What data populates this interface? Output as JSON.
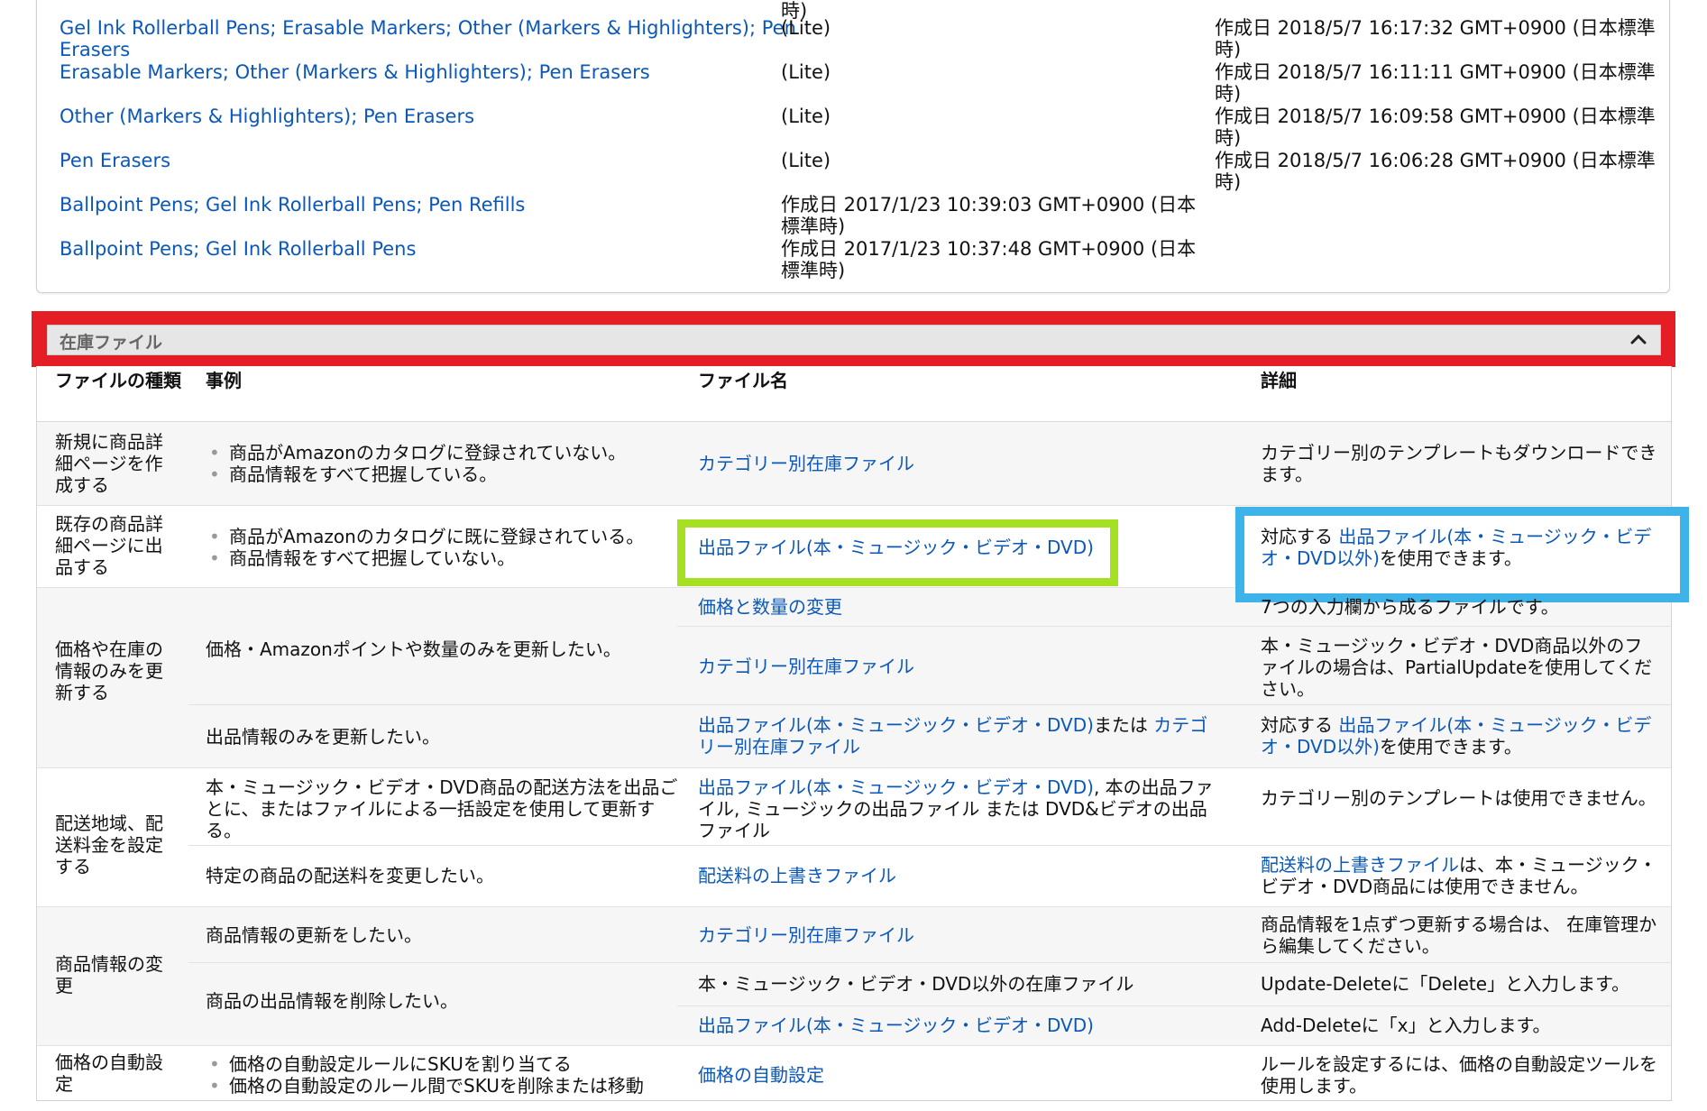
{
  "top_list": {
    "clipped_fragment": "時)",
    "rows": [
      {
        "name": "Gel Ink Rollerball Pens; Erasable Markers; Other (Markers & Highlighters); Pen Erasers",
        "mid": "(Lite)",
        "date": "作成日 2018/5/7 16:17:32 GMT+0900 (日本標準時)"
      },
      {
        "name": "Erasable Markers; Other (Markers & Highlighters); Pen Erasers",
        "mid": "(Lite)",
        "date": "作成日 2018/5/7 16:11:11 GMT+0900 (日本標準時)"
      },
      {
        "name": "Other (Markers & Highlighters); Pen Erasers",
        "mid": "(Lite)",
        "date": "作成日 2018/5/7 16:09:58 GMT+0900 (日本標準時)"
      },
      {
        "name": "Pen Erasers",
        "mid": "(Lite)",
        "date": "作成日 2018/5/7 16:06:28 GMT+0900 (日本標準時)"
      },
      {
        "name": "Ballpoint Pens; Gel Ink Rollerball Pens; Pen Refills",
        "mid": "作成日 2017/1/23 10:39:03 GMT+0900 (日本標準時)",
        "date": ""
      },
      {
        "name": "Ballpoint Pens; Gel Ink Rollerball Pens",
        "mid": "作成日 2017/1/23 10:37:48 GMT+0900 (日本標準時)",
        "date": ""
      }
    ]
  },
  "inventory": {
    "title": "在庫ファイル",
    "collapse_icon": "chevron-up-icon",
    "headers": {
      "type": "ファイルの種類",
      "case": "事例",
      "file": "ファイル名",
      "detail": "詳細"
    },
    "rows": {
      "new": {
        "type": "新規に商品詳細ページを作成する",
        "bullets": [
          "商品がAmazonのカタログに登録されていない。",
          "商品情報をすべて把握している。"
        ],
        "file": "カテゴリー別在庫ファイル",
        "detail": "カテゴリー別のテンプレートもダウンロードできます。"
      },
      "existing": {
        "type": "既存の商品詳細ページに出品する",
        "bullets": [
          "商品がAmazonのカタログに既に登録されている。",
          "商品情報をすべて把握していない。"
        ],
        "file": "出品ファイル(本・ミュージック・ビデオ・DVD)",
        "detail_prefix": "対応する ",
        "detail_link": "出品ファイル(本・ミュージック・ビデオ・DVD以外)",
        "detail_suffix": "を使用できます。"
      },
      "price": {
        "type": "価格や在庫の情報のみを更新する",
        "case1": "価格・Amazonポイントや数量のみを更新したい。",
        "file1a": "価格と数量の変更",
        "detail1a": "7つの入力欄から成るファイルです。",
        "file1b": "カテゴリー別在庫ファイル",
        "detail1b": "本・ミュージック・ビデオ・DVD商品以外のファイルの場合は、PartialUpdateを使用してください。",
        "case2": "出品情報のみを更新したい。",
        "file2_link1": "出品ファイル(本・ミュージック・ビデオ・DVD)",
        "file2_mid": "または ",
        "file2_link2": "カテゴリー別在庫ファイル",
        "detail2_prefix": "対応する ",
        "detail2_link": "出品ファイル(本・ミュージック・ビデオ・DVD以外)",
        "detail2_suffix": "を使用できます。"
      },
      "shipping": {
        "type": "配送地域、配送料金を設定する",
        "case1": "本・ミュージック・ビデオ・DVD商品の配送方法を出品ごとに、またはファイルによる一括設定を使用して更新する。",
        "file1_link": "出品ファイル(本・ミュージック・ビデオ・DVD)",
        "file1_text": ", 本の出品ファイル, ミュージックの出品ファイル または DVD&ビデオの出品ファイル",
        "detail1": "カテゴリー別のテンプレートは使用できません。",
        "case2": "特定の商品の配送料を変更したい。",
        "file2": "配送料の上書きファイル",
        "detail2_link": "配送料の上書きファイル",
        "detail2_text": "は、本・ミュージック・ビデオ・DVD商品には使用できません。"
      },
      "edit": {
        "type": "商品情報の変更",
        "case1": "商品情報の更新をしたい。",
        "file1": "カテゴリー別在庫ファイル",
        "detail1": "商品情報を1点ずつ更新する場合は、 在庫管理から編集してください。",
        "case2": "商品の出品情報を削除したい。",
        "file2a": "本・ミュージック・ビデオ・DVD以外の在庫ファイル",
        "detail2a": "Update-Deleteに「Delete」と入力します。",
        "file2b": "出品ファイル(本・ミュージック・ビデオ・DVD)",
        "detail2b": "Add-Deleteに「x」と入力します。"
      },
      "auto": {
        "type": "価格の自動設定",
        "bullets": [
          "価格の自動設定ルールにSKUを割り当てる",
          "価格の自動設定のルール間でSKUを削除または移動"
        ],
        "file": "価格の自動設定",
        "detail": "ルールを設定するには、価格の自動設定ツールを使用します。"
      }
    }
  },
  "highlight_colors": {
    "red": "#e51e25",
    "green": "#a6e022",
    "blue": "#3db3ea",
    "link": "#0b58b8"
  }
}
